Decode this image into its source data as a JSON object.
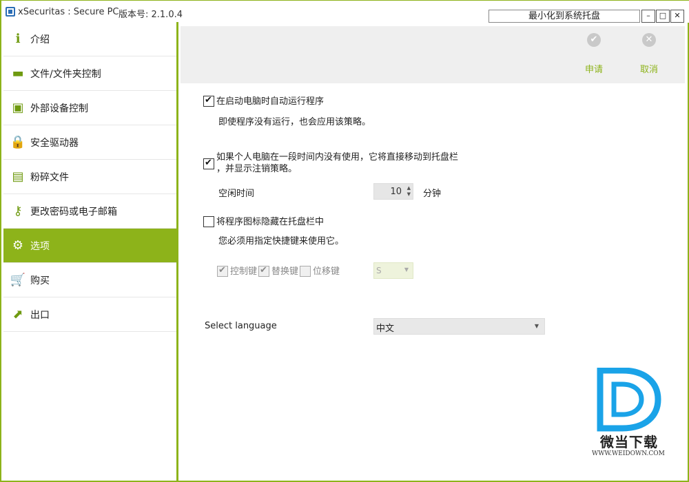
{
  "window": {
    "title": "xSecuritas : Secure PC",
    "version": "版本号: 2.1.0.4",
    "tray_button": "最小化到系统托盘",
    "min_glyph": "–",
    "max_glyph": "□",
    "close_glyph": "✕"
  },
  "sidebar": {
    "items": [
      {
        "label": "介绍",
        "icon": "info-icon",
        "glyph": "ℹ"
      },
      {
        "label": "文件/文件夹控制",
        "icon": "folder-icon",
        "glyph": "▬"
      },
      {
        "label": "外部设备控制",
        "icon": "usb-icon",
        "glyph": "▣"
      },
      {
        "label": "安全驱动器",
        "icon": "lock-icon",
        "glyph": "🔒"
      },
      {
        "label": "粉碎文件",
        "icon": "shredder-icon",
        "glyph": "▤"
      },
      {
        "label": "更改密码或电子邮箱",
        "icon": "key-icon",
        "glyph": "⚷"
      },
      {
        "label": "选项",
        "icon": "gear-icon",
        "glyph": "⚙"
      },
      {
        "label": "购买",
        "icon": "cart-icon",
        "glyph": "🛒"
      },
      {
        "label": "出口",
        "icon": "exit-icon",
        "glyph": "⬈"
      }
    ],
    "active_index": 6
  },
  "actions": {
    "apply_label": "申请",
    "apply_glyph": "✔",
    "cancel_label": "取消",
    "cancel_glyph": "✕"
  },
  "options": {
    "autorun": {
      "label": "在启动电脑时自动运行程序",
      "checked": true,
      "note": "即使程序没有运行，也会应用该策略。"
    },
    "idle_tray": {
      "label_line1": "如果个人电脑在一段时间内没有使用，它将直接移动到托盘栏",
      "label_line2": "，并显示注销策略。",
      "checked": true
    },
    "idle_time": {
      "label": "空闲时间",
      "value": "10",
      "unit": "分钟"
    },
    "hide_icon": {
      "label": "将程序图标隐藏在托盘栏中",
      "checked": false,
      "note": "您必须用指定快捷键来使用它。"
    },
    "hotkey": {
      "ctrl_label": "控制键",
      "alt_label": "替换键",
      "shift_label": "位移键",
      "key_value": "S",
      "ctrl_checked": true,
      "alt_checked": true,
      "shift_checked": false
    },
    "language": {
      "label": "Select language",
      "value": "中文"
    }
  },
  "watermark": {
    "text": "微当下载",
    "url": "WWW.WEIDOWN.COM"
  },
  "colors": {
    "accent": "#8db31a",
    "watermark_blue": "#1aa3e8"
  }
}
